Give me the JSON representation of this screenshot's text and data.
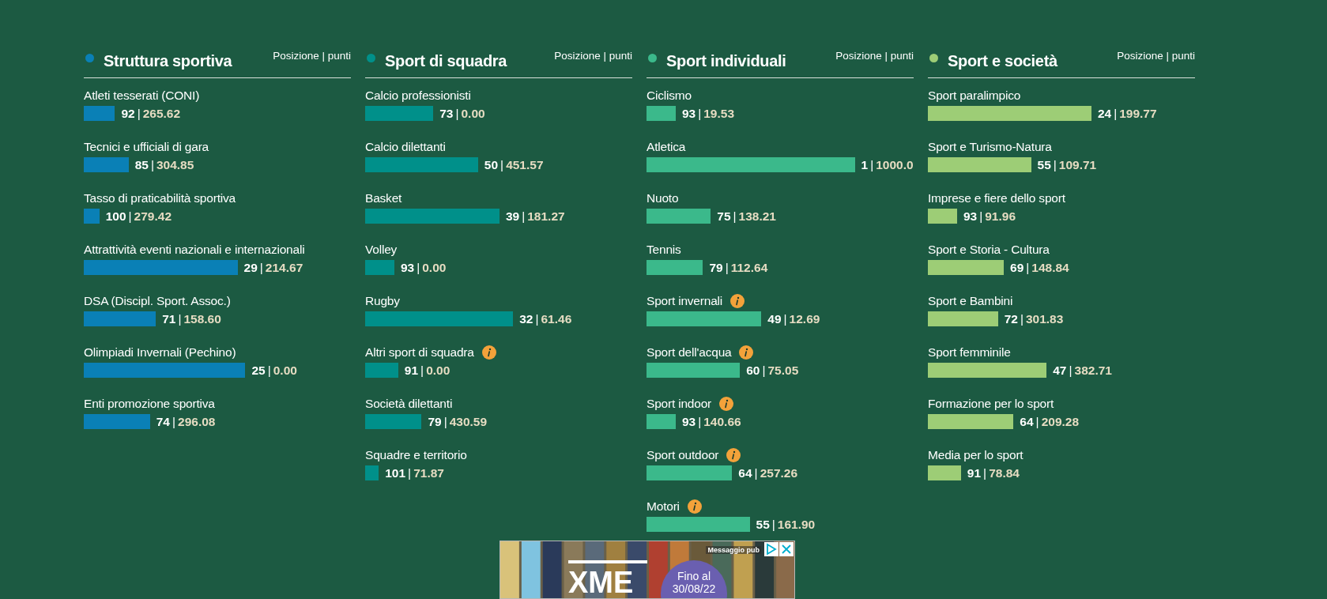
{
  "panels": [
    {
      "title": "Struttura sportiva",
      "legend": "Posizione | punti",
      "color": "#0a80b6",
      "items": [
        {
          "label": "Atleti tesserati (CONI)",
          "rank": "92",
          "sep": "|",
          "score": "265.62",
          "info": false
        },
        {
          "label": "Tecnici e ufficiali di gara",
          "rank": "85",
          "sep": "|",
          "score": "304.85",
          "info": false
        },
        {
          "label": "Tasso di praticabilità sportiva",
          "rank": "100",
          "sep": "|",
          "score": "279.42",
          "info": false
        },
        {
          "label": "Attrattività eventi nazionali e internazionali",
          "rank": "29",
          "sep": "|",
          "score": "214.67",
          "info": false
        },
        {
          "label": "DSA (Discipl. Sport. Assoc.)",
          "rank": "71",
          "sep": "|",
          "score": "158.60",
          "info": false
        },
        {
          "label": "Olimpiadi Invernali (Pechino)",
          "rank": "25",
          "sep": "|",
          "score": "0.00",
          "info": false
        },
        {
          "label": "Enti promozione sportiva",
          "rank": "74",
          "sep": "|",
          "score": "296.08",
          "info": false
        }
      ]
    },
    {
      "title": "Sport di squadra",
      "legend": "Posizione | punti",
      "color": "#00908a",
      "items": [
        {
          "label": "Calcio professionisti",
          "rank": "73",
          "sep": "|",
          "score": "0.00",
          "info": false
        },
        {
          "label": "Calcio dilettanti",
          "rank": "50",
          "sep": "|",
          "score": "451.57",
          "info": false
        },
        {
          "label": "Basket",
          "rank": "39",
          "sep": "|",
          "score": "181.27",
          "info": false
        },
        {
          "label": "Volley",
          "rank": "93",
          "sep": "|",
          "score": "0.00",
          "info": false
        },
        {
          "label": "Rugby",
          "rank": "32",
          "sep": "|",
          "score": "61.46",
          "info": false
        },
        {
          "label": "Altri sport di squadra",
          "rank": "91",
          "sep": "|",
          "score": "0.00",
          "info": true
        },
        {
          "label": "Società dilettanti",
          "rank": "79",
          "sep": "|",
          "score": "430.59",
          "info": false
        },
        {
          "label": "Squadre e territorio",
          "rank": "101",
          "sep": "|",
          "score": "71.87",
          "info": false
        }
      ]
    },
    {
      "title": "Sport individuali",
      "legend": "Posizione | punti",
      "color": "#3bb98b",
      "items": [
        {
          "label": "Ciclismo",
          "rank": "93",
          "sep": "|",
          "score": "19.53",
          "info": false
        },
        {
          "label": "Atletica",
          "rank": "1",
          "sep": "|",
          "score": "1000.0",
          "info": false
        },
        {
          "label": "Nuoto",
          "rank": "75",
          "sep": "|",
          "score": "138.21",
          "info": false
        },
        {
          "label": "Tennis",
          "rank": "79",
          "sep": "|",
          "score": "112.64",
          "info": false
        },
        {
          "label": "Sport invernali",
          "rank": "49",
          "sep": "|",
          "score": "12.69",
          "info": true
        },
        {
          "label": "Sport dell'acqua",
          "rank": "60",
          "sep": "|",
          "score": "75.05",
          "info": true
        },
        {
          "label": "Sport indoor",
          "rank": "93",
          "sep": "|",
          "score": "140.66",
          "info": true
        },
        {
          "label": "Sport outdoor",
          "rank": "64",
          "sep": "|",
          "score": "257.26",
          "info": true
        },
        {
          "label": "Motori",
          "rank": "55",
          "sep": "|",
          "score": "161.90",
          "info": true
        }
      ]
    },
    {
      "title": "Sport e società",
      "legend": "Posizione | punti",
      "color": "#9dcd76",
      "items": [
        {
          "label": "Sport paralimpico",
          "rank": "24",
          "sep": "|",
          "score": "199.77",
          "info": false
        },
        {
          "label": "Sport e Turismo-Natura",
          "rank": "55",
          "sep": "|",
          "score": "109.71",
          "info": false
        },
        {
          "label": "Imprese e fiere dello sport",
          "rank": "93",
          "sep": "|",
          "score": "91.96",
          "info": false
        },
        {
          "label": "Sport e Storia - Cultura",
          "rank": "69",
          "sep": "|",
          "score": "148.84",
          "info": false
        },
        {
          "label": "Sport e Bambini",
          "rank": "72",
          "sep": "|",
          "score": "301.83",
          "info": false
        },
        {
          "label": "Sport femminile",
          "rank": "47",
          "sep": "|",
          "score": "382.71",
          "info": false
        },
        {
          "label": "Formazione per lo sport",
          "rank": "64",
          "sep": "|",
          "score": "209.28",
          "info": false
        },
        {
          "label": "Media per lo sport",
          "rank": "91",
          "sep": "|",
          "score": "78.84",
          "info": false
        }
      ]
    }
  ],
  "ad": {
    "notice": "Messaggio pub",
    "logo": "XME",
    "badge": [
      "Fino al",
      "30/08/22"
    ]
  }
}
